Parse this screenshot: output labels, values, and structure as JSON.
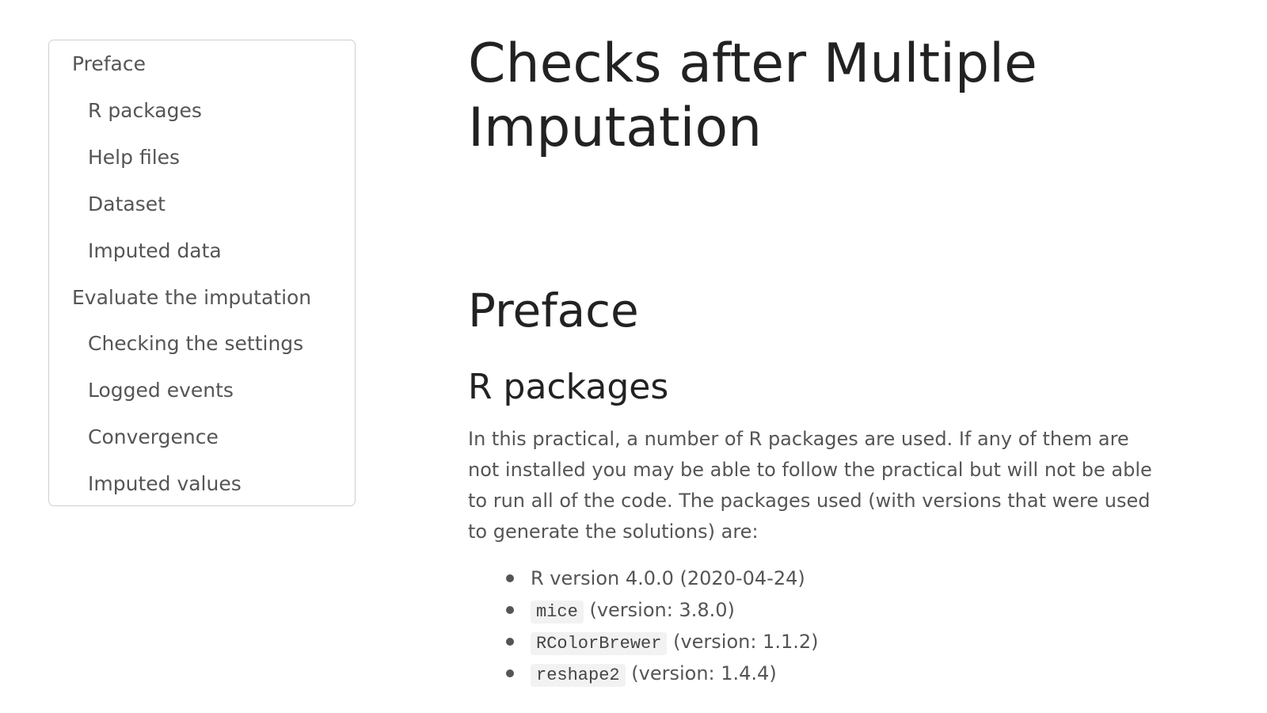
{
  "toc": {
    "items": [
      {
        "label": "Preface",
        "level": 1
      },
      {
        "label": "R packages",
        "level": 2
      },
      {
        "label": "Help files",
        "level": 2
      },
      {
        "label": "Dataset",
        "level": 2
      },
      {
        "label": "Imputed data",
        "level": 2
      },
      {
        "label": "Evaluate the imputation",
        "level": 1
      },
      {
        "label": "Checking the settings",
        "level": 2
      },
      {
        "label": "Logged events",
        "level": 2
      },
      {
        "label": "Convergence",
        "level": 2
      },
      {
        "label": "Imputed values",
        "level": 2
      }
    ]
  },
  "main": {
    "title": "Checks after Multiple Imputation",
    "section_heading": "Preface",
    "subsection_heading": "R packages",
    "paragraph": "In this practical, a number of R packages are used. If any of them are not installed you may be able to follow the practical but will not be able to run all of the code. The packages used (with versions that were used to generate the solutions) are:",
    "packages": [
      {
        "text": "R version 4.0.0 (2020-04-24)"
      },
      {
        "code": "mice",
        "text": "(version: 3.8.0)"
      },
      {
        "code": "RColorBrewer",
        "text": "(version: 1.1.2)"
      },
      {
        "code": "reshape2",
        "text": "(version: 1.4.4)"
      }
    ]
  }
}
